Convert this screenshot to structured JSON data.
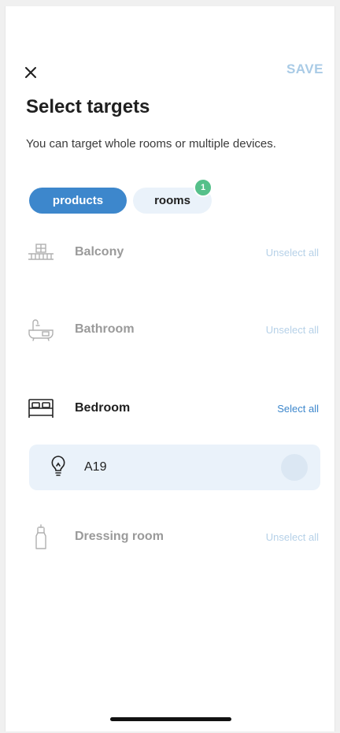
{
  "header": {
    "close_glyph": "×",
    "save_label": "SAVE"
  },
  "title": "Select targets",
  "subtitle": "You can target whole rooms or multiple devices.",
  "tabs": [
    {
      "label": "products",
      "active": true
    },
    {
      "label": "rooms",
      "active": false,
      "badge": "1"
    }
  ],
  "rooms": [
    {
      "name": "Balcony",
      "icon": "balcony-icon",
      "action": "Unselect all",
      "active": false
    },
    {
      "name": "Bathroom",
      "icon": "bathtub-icon",
      "action": "Unselect all",
      "active": false
    },
    {
      "name": "Bedroom",
      "icon": "bed-icon",
      "action": "Select all",
      "active": true
    },
    {
      "name": "Dressing room",
      "icon": "dress-icon",
      "action": "Unselect all",
      "active": false
    }
  ],
  "devices": [
    {
      "name": "A19",
      "icon": "lightbulb-icon",
      "room": "Bedroom",
      "selected": false
    }
  ],
  "colors": {
    "accent": "#3d87cc",
    "accent_light": "#eaf2fa",
    "badge": "#55c08a",
    "muted_action": "#b6d1e8"
  }
}
